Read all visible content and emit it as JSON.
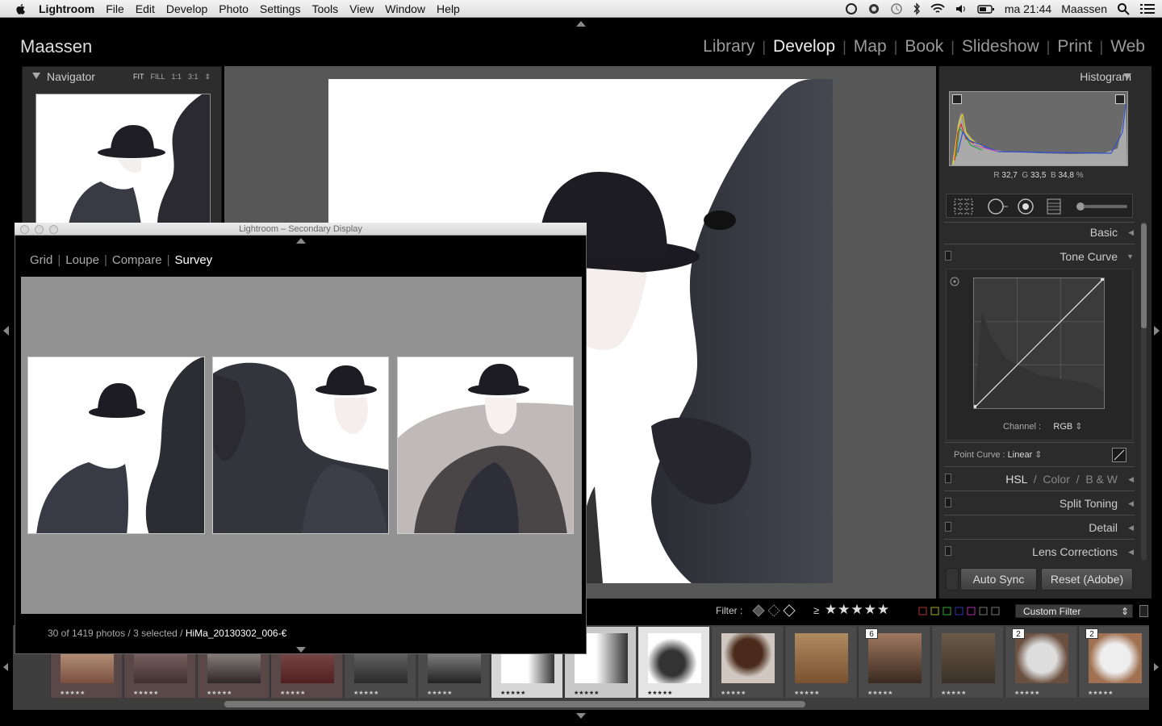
{
  "menubar": {
    "app": "Lightroom",
    "items": [
      "File",
      "Edit",
      "Develop",
      "Photo",
      "Settings",
      "Tools",
      "View",
      "Window",
      "Help"
    ],
    "clock": "ma 21:44",
    "user": "Maassen"
  },
  "identity_plate": "Maassen",
  "modules": [
    {
      "label": "Library",
      "active": false
    },
    {
      "label": "Develop",
      "active": true
    },
    {
      "label": "Map",
      "active": false
    },
    {
      "label": "Book",
      "active": false
    },
    {
      "label": "Slideshow",
      "active": false
    },
    {
      "label": "Print",
      "active": false
    },
    {
      "label": "Web",
      "active": false
    }
  ],
  "navigator": {
    "title": "Navigator",
    "options": [
      "FIT",
      "FILL",
      "1:1",
      "3:1"
    ]
  },
  "right_panel": {
    "histogram_title": "Histogram",
    "rgb": {
      "r_label": "R",
      "r": "32,7",
      "g_label": "G",
      "g": "33,5",
      "b_label": "B",
      "b": "34,8",
      "unit": "%"
    },
    "basic": "Basic",
    "tone_curve": "Tone Curve",
    "channel_label": "Channel :",
    "channel_value": "RGB",
    "point_curve_label": "Point Curve :",
    "point_curve_value": "Linear",
    "hsl": "HSL",
    "color": "Color",
    "bw": "B & W",
    "split_toning": "Split Toning",
    "detail": "Detail",
    "lens_corrections": "Lens Corrections",
    "auto_sync": "Auto Sync",
    "reset": "Reset (Adobe)"
  },
  "filter": {
    "label": "Filter :",
    "gte": "≥",
    "stars": "★★★★★",
    "custom_filter": "Custom Filter"
  },
  "secondary_display": {
    "title": "Lightroom – Secondary Display",
    "tabs": [
      {
        "label": "Grid",
        "active": false
      },
      {
        "label": "Loupe",
        "active": false
      },
      {
        "label": "Compare",
        "active": false
      },
      {
        "label": "Survey",
        "active": true
      }
    ],
    "status_prefix": "30 of 1419 photos / 3 selected /",
    "status_file": "HiMa_20130302_006-€"
  },
  "filmstrip_numbers": {
    "n1": "6",
    "n2": "2",
    "n3": "2"
  },
  "filmstrip_stars": "★★★★★",
  "colors": {
    "active_module": "#eeeeee",
    "inactive_module": "#999999",
    "panel_bg": "#2b2b2b",
    "center_bg": "#575757",
    "survey_bg": "#929292"
  }
}
